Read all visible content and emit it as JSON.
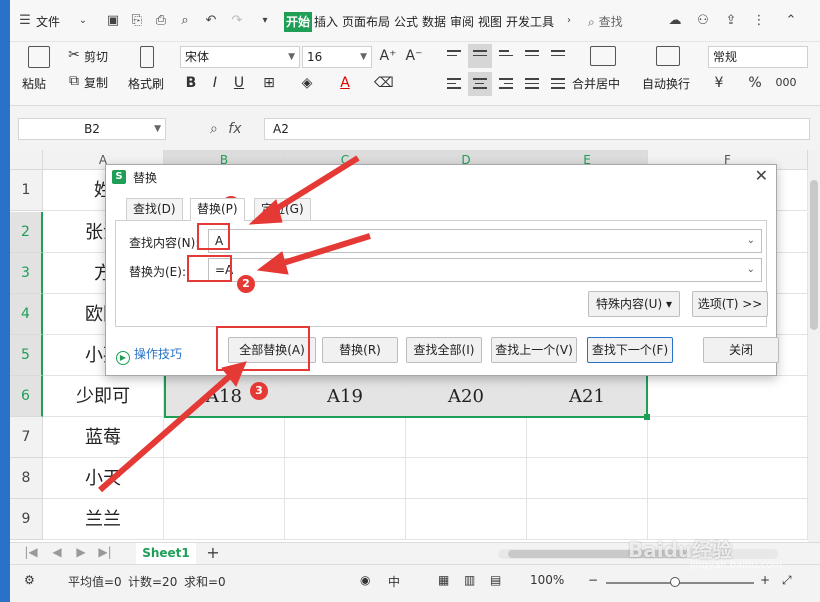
{
  "menubar": {
    "file": "文件",
    "tabs": [
      "开始",
      "插入",
      "页面布局",
      "公式",
      "数据",
      "审阅",
      "视图",
      "开发工具"
    ],
    "search": "查找"
  },
  "ribbon": {
    "paste": "粘贴",
    "cut": "剪切",
    "copy": "复制",
    "format_painter": "格式刷",
    "font_name": "宋体",
    "font_size": "16",
    "bold": "B",
    "italic": "I",
    "underline": "U",
    "font_color": "A",
    "grow": "A⁺",
    "shrink": "A⁻",
    "merge_center": "合并居中",
    "wrap_text": "自动换行",
    "number_format": "常规",
    "currency": "¥",
    "percent": "%",
    "thousands": "000"
  },
  "formulabar": {
    "name_box": "B2",
    "fx": "fx",
    "content": "A2"
  },
  "grid": {
    "columns": [
      "A",
      "B",
      "C",
      "D",
      "E",
      "F"
    ],
    "rows": [
      "1",
      "2",
      "3",
      "4",
      "5",
      "6",
      "7",
      "8",
      "9"
    ],
    "col_a": [
      "姓",
      "张浩",
      "方",
      "欧阳",
      "小孩",
      "少即可",
      "蓝莓",
      "小天",
      "兰兰"
    ],
    "row6_values": [
      "A18",
      "A19",
      "A20",
      "A21"
    ]
  },
  "sheetbar": {
    "sheet_name": "Sheet1",
    "add": "+"
  },
  "statusbar": {
    "average": "平均值=0",
    "count": "计数=20",
    "sum": "求和=0",
    "zoom": "100%",
    "zoom_minus": "−",
    "zoom_plus": "+"
  },
  "dialog": {
    "title": "替换",
    "tabs": [
      "查找(D)",
      "替换(P)",
      "定位(G)"
    ],
    "find_label": "查找内容(N):",
    "find_value": "A",
    "replace_label": "替换为(E):",
    "replace_value": "=A",
    "special_btn": "特殊内容(U)",
    "options_btn": "选项(T) >>",
    "tips": "操作技巧",
    "buttons": [
      "全部替换(A)",
      "替换(R)",
      "查找全部(I)",
      "查找上一个(V)",
      "查找下一个(F)",
      "关闭"
    ]
  },
  "annotations": [
    "1",
    "2",
    "3"
  ],
  "watermark": "Baidu经验",
  "watermark_sub": "jingyan.baidu.com"
}
